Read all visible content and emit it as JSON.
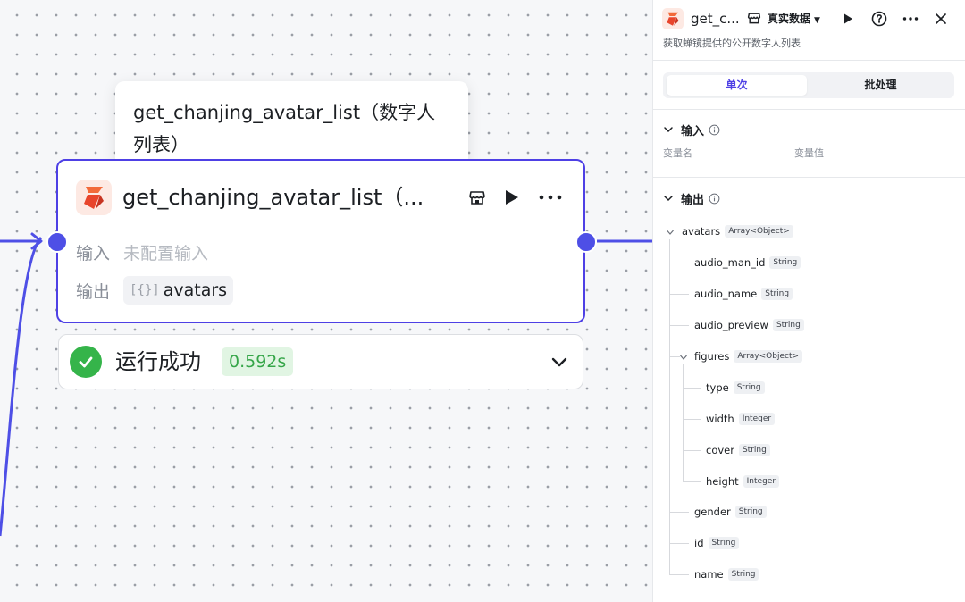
{
  "tooltip": {
    "text": "get_chanjing_avatar_list（数字人列表）"
  },
  "node": {
    "title": "get_chanjing_avatar_list（...",
    "input_label": "输入",
    "input_value": "未配置输入",
    "output_label": "输出",
    "output_value": "avatars",
    "output_icon_text": "[{}]"
  },
  "status": {
    "text": "运行成功",
    "duration": "0.592s"
  },
  "panel": {
    "title": "get_c...",
    "source_label": "真实数据",
    "description": "获取蝉镜提供的公开数字人列表",
    "tabs": [
      "单次",
      "批处理"
    ],
    "input_section": {
      "title": "输入",
      "col_name": "变量名",
      "col_value": "变量值"
    },
    "output_section": {
      "title": "输出",
      "root": {
        "name": "avatars",
        "type": "Array<Object>"
      },
      "fields": [
        {
          "name": "audio_man_id",
          "type": "String"
        },
        {
          "name": "audio_name",
          "type": "String"
        },
        {
          "name": "audio_preview",
          "type": "String"
        },
        {
          "name": "figures",
          "type": "Array<Object>"
        },
        {
          "name": "type",
          "type": "String"
        },
        {
          "name": "width",
          "type": "Integer"
        },
        {
          "name": "cover",
          "type": "String"
        },
        {
          "name": "height",
          "type": "Integer"
        },
        {
          "name": "gender",
          "type": "String"
        },
        {
          "name": "id",
          "type": "String"
        },
        {
          "name": "name",
          "type": "String"
        }
      ]
    }
  },
  "colors": {
    "accent": "#4e40e5",
    "port": "#4e4fe6",
    "success": "#35b44a"
  },
  "icons": {
    "logo": "flame-logo-icon",
    "store": "store-icon",
    "run": "play-icon",
    "more": "more-dots-icon",
    "help": "help-circle-icon",
    "close": "close-icon",
    "status": "check-circle-icon",
    "expand": "chevron-down-icon",
    "info": "info-icon"
  }
}
